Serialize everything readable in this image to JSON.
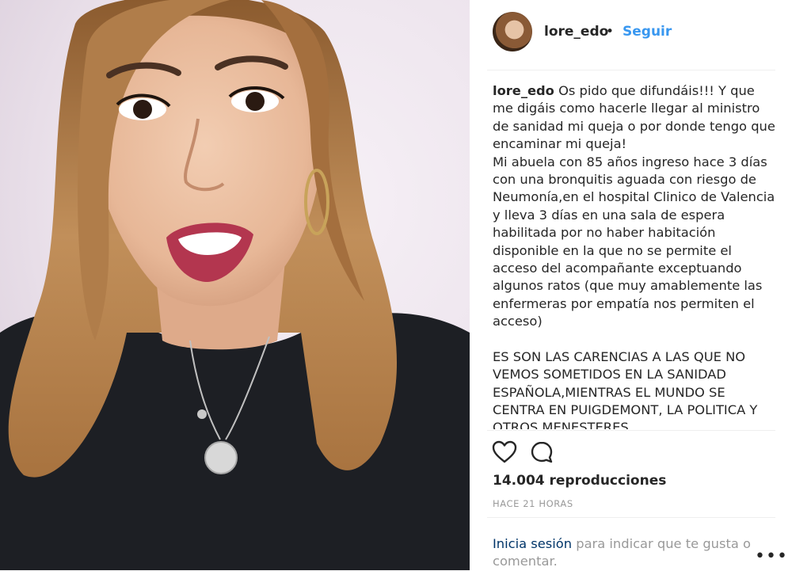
{
  "post": {
    "media": {
      "type": "video"
    },
    "header": {
      "username": "lore_edo",
      "separator": "•",
      "follow_label": "Seguir"
    },
    "caption": {
      "author": "lore_edo",
      "paragraph1": "Os pido que difundáis!!! Y que me digáis como hacerle llegar al ministro de sanidad mi queja o por donde tengo que encaminar mi queja!",
      "paragraph2": "Mi abuela con 85 años ingreso hace 3 días con una bronquitis aguada con riesgo de Neumonía,en el hospital Clinico de Valencia y lleva 3 días en una sala de espera habilitada por no haber habitación disponible en la que no se permite el acceso del acompañante exceptuando algunos ratos (que muy amablemente las enfermeras por empatía nos permiten el acceso)",
      "paragraph3": "ES SON LAS CARENCIAS A LAS QUE NO VEMOS SOMETIDOS EN LA SANIDAD ESPAÑOLA,MIENTRAS EL MUNDO SE CENTRA EN PUIGDEMONT, LA POLITICA Y OTROS MENESTERES"
    },
    "icons": {
      "like": "heart-icon",
      "comment": "comment-bubble-icon",
      "more": "ellipsis-icon"
    },
    "views": "14.004 reproducciones",
    "timestamp": "HACE 21 HORAS",
    "login": {
      "link": "Inicia sesión",
      "text": " para indicar que te gusta o comentar."
    },
    "more_label": "•••",
    "colors": {
      "accent": "#3897f0",
      "link_dark": "#003569",
      "text": "#262626",
      "muted": "#999999"
    }
  }
}
